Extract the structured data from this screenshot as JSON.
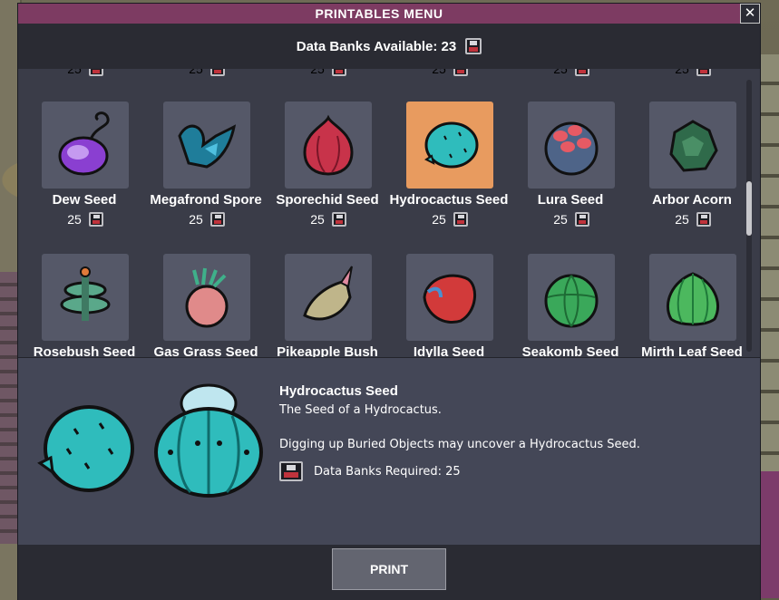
{
  "window": {
    "title": "PRINTABLES MENU",
    "close_symbol": "✕"
  },
  "header": {
    "data_banks_label": "Data Banks Available: 23"
  },
  "grid": {
    "partial_row_costs": [
      "25",
      "25",
      "25",
      "25",
      "25",
      "25"
    ],
    "rows": [
      [
        {
          "name": "Dew Seed",
          "cost": "25",
          "icon": "dew-seed-icon",
          "selected": false
        },
        {
          "name": "Megafrond Spore",
          "cost": "25",
          "icon": "megafrond-spore-icon",
          "selected": false
        },
        {
          "name": "Sporechid Seed",
          "cost": "25",
          "icon": "sporechid-seed-icon",
          "selected": false
        },
        {
          "name": "Hydrocactus Seed",
          "cost": "25",
          "icon": "hydrocactus-seed-icon",
          "selected": true
        },
        {
          "name": "Lura Seed",
          "cost": "25",
          "icon": "lura-seed-icon",
          "selected": false
        },
        {
          "name": "Arbor Acorn",
          "cost": "25",
          "icon": "arbor-acorn-icon",
          "selected": false
        }
      ],
      [
        {
          "name": "Rosebush Seed",
          "icon": "rosebush-seed-icon"
        },
        {
          "name": "Gas Grass Seed",
          "icon": "gas-grass-seed-icon"
        },
        {
          "name": "Pikeapple Bush Seed",
          "icon": "pikeapple-bush-seed-icon"
        },
        {
          "name": "Idylla Seed",
          "icon": "idylla-seed-icon"
        },
        {
          "name": "Seakomb Seed",
          "icon": "seakomb-seed-icon"
        },
        {
          "name": "Mirth Leaf Seed",
          "icon": "mirth-leaf-seed-icon"
        }
      ]
    ]
  },
  "details": {
    "title": "Hydrocactus Seed",
    "description": "The Seed of a Hydrocactus.",
    "hint": "Digging up Buried Objects may uncover a Hydrocactus Seed.",
    "requirement": "Data Banks Required: 25"
  },
  "footer": {
    "print_label": "PRINT"
  },
  "colors": {
    "title_bar": "#7d3b62",
    "selected_tile": "#e89b5f",
    "tile": "#555868"
  }
}
